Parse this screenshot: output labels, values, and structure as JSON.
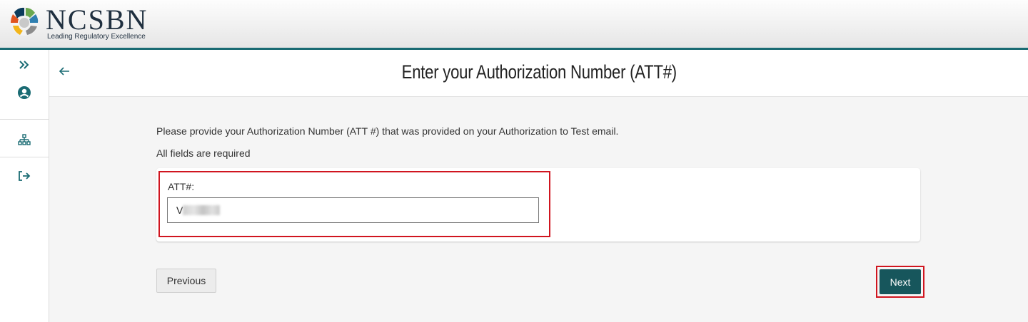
{
  "header": {
    "logo_text": "NCSBN",
    "logo_tagline": "Leading Regulatory Excellence",
    "accent_color": "#1a6b73"
  },
  "sidebar": {
    "items": [
      {
        "icon": "expand-chevrons-icon"
      },
      {
        "icon": "user-circle-icon"
      },
      {
        "icon": "sitemap-icon"
      },
      {
        "icon": "logout-icon"
      }
    ]
  },
  "page": {
    "back_icon": "back-arrow-icon",
    "title": "Enter your Authorization Number (ATT#)",
    "instruction": "Please provide your Authorization Number (ATT #) that was provided on your Authorization to Test email.",
    "required_note": "All fields are required"
  },
  "form": {
    "att_label": "ATT#:",
    "att_value": "V"
  },
  "buttons": {
    "previous": "Previous",
    "next": "Next",
    "next_color": "#17565c"
  }
}
